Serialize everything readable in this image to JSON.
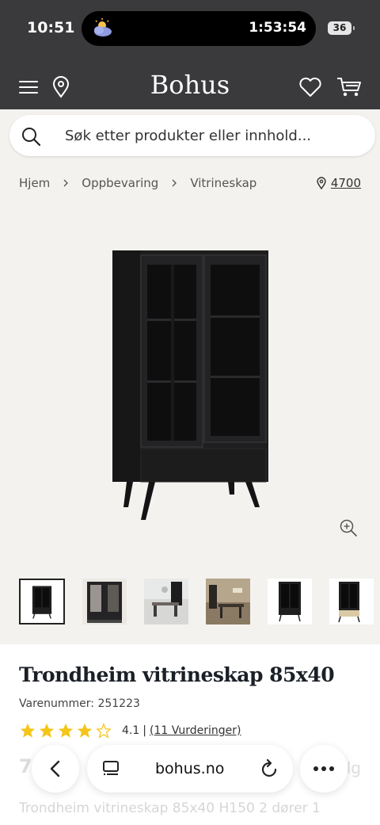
{
  "status": {
    "time": "10:51",
    "timer": "1:53:54",
    "battery": "36"
  },
  "header": {
    "logo": "Bohus"
  },
  "search": {
    "placeholder": "Søk etter produkter eller innhold..."
  },
  "breadcrumb": [
    "Hjem",
    "Oppbevaring",
    "Vitrineskap"
  ],
  "store": {
    "code": "4700"
  },
  "product": {
    "title": "Trondheim vitrineskap 85x40",
    "sku": "Varenummer: 251223",
    "rating": 4.1,
    "rating_text": "4.1",
    "reviews": "(11 Vurderinger)",
    "price_fragment": "7",
    "price_suffix": "lg",
    "description": "Trondheim vitrineskap 85x40 H150 2 dører 1"
  },
  "thumbnails": [
    "product-front",
    "product-open",
    "room-dining",
    "room-lounge",
    "product-plain",
    "product-angle"
  ],
  "browser": {
    "url": "bohus.no"
  },
  "colors": {
    "header_bg": "#3a3a3c",
    "page_bg": "#f4f2ef",
    "star": "#f5c518"
  }
}
